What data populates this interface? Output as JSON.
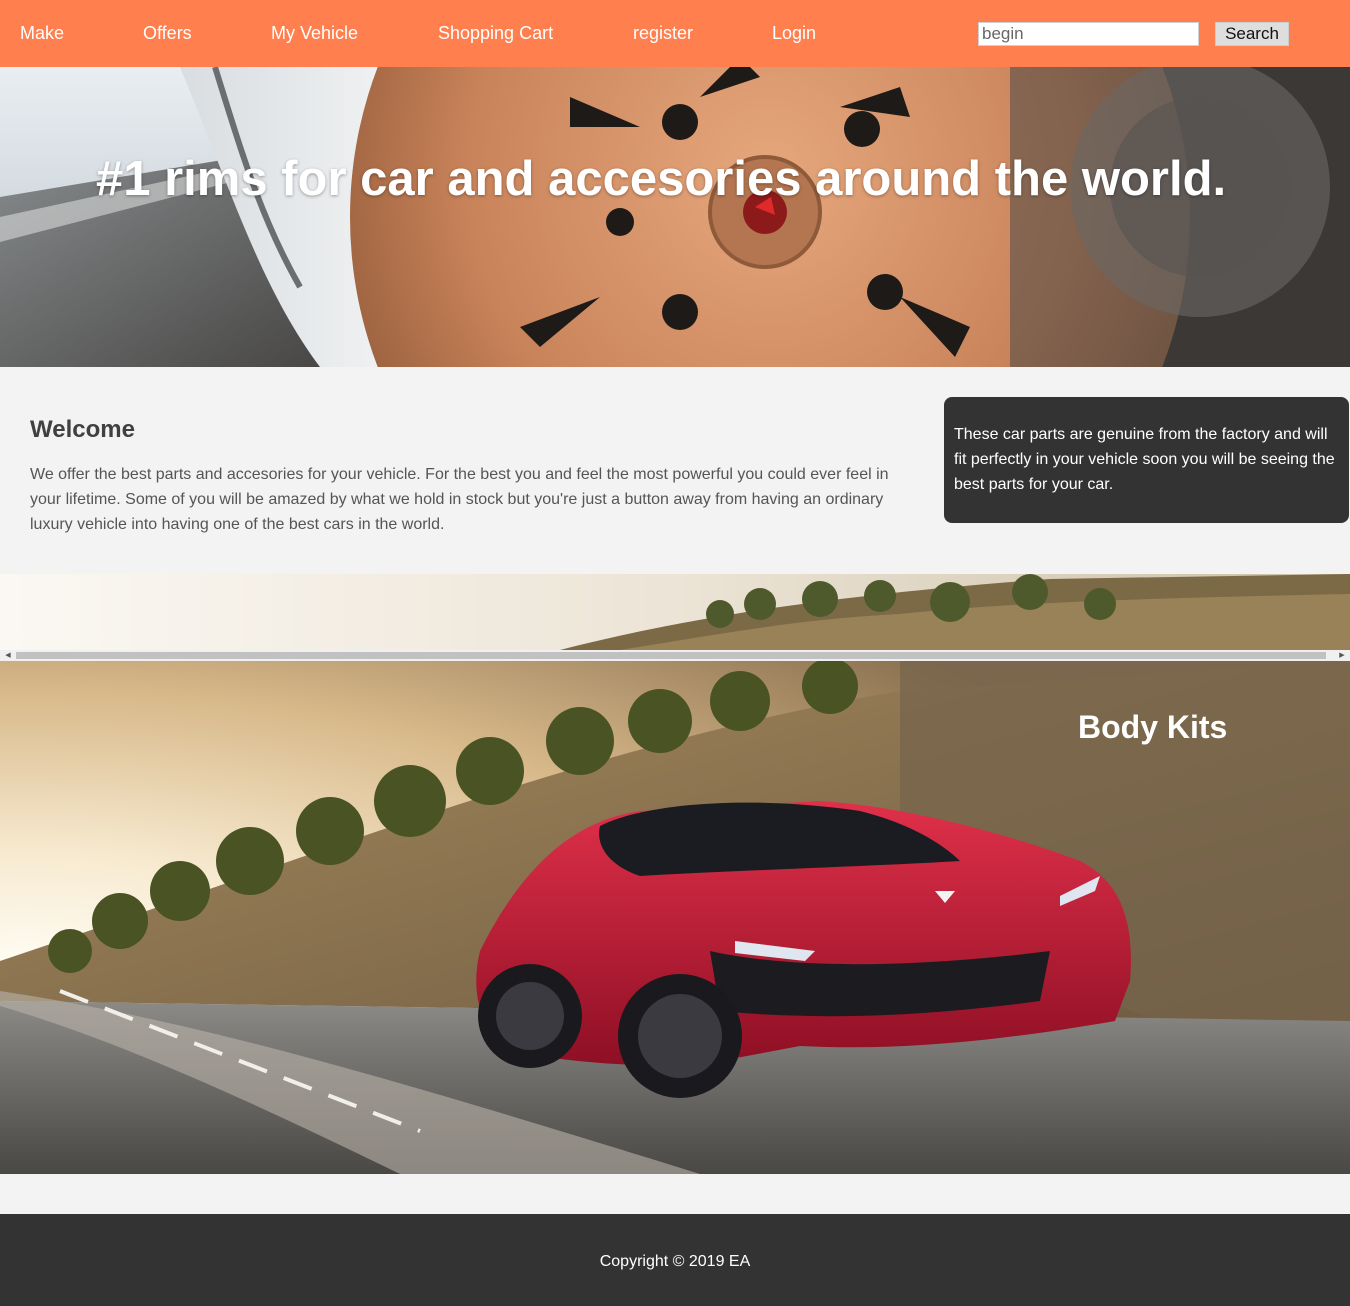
{
  "nav": {
    "links": [
      "Make",
      "Offers",
      "My Vehicle",
      "Shopping Cart",
      "register",
      "Login"
    ],
    "search_value": "begin",
    "search_button": "Search"
  },
  "hero": {
    "title": "#1 rims for car and accesories around the world.",
    "image": "car-rim-photo"
  },
  "welcome": {
    "heading": "Welcome",
    "text": "We offer the best parts and accesories for your vehicle. For the best you and feel the most powerful you could ever feel in your lifetime. Some of you will be amazed by what we hold in stock but you're just a button away from having an ordinary luxury vehicle into having one of the best cars in the world."
  },
  "info_box": {
    "text": "These car parts are genuine from the factory and will fit perfectly in your vehicle soon you will be seeing the best parts for your car."
  },
  "body_kits": {
    "title": "Body Kits",
    "image": "red-sports-car-photo"
  },
  "footer": {
    "copyright": "Copyright © 2019 EA"
  },
  "colors": {
    "nav_bg": "#ff7f4f",
    "dark_box": "#333333",
    "page_bg": "#f3f3f3"
  }
}
